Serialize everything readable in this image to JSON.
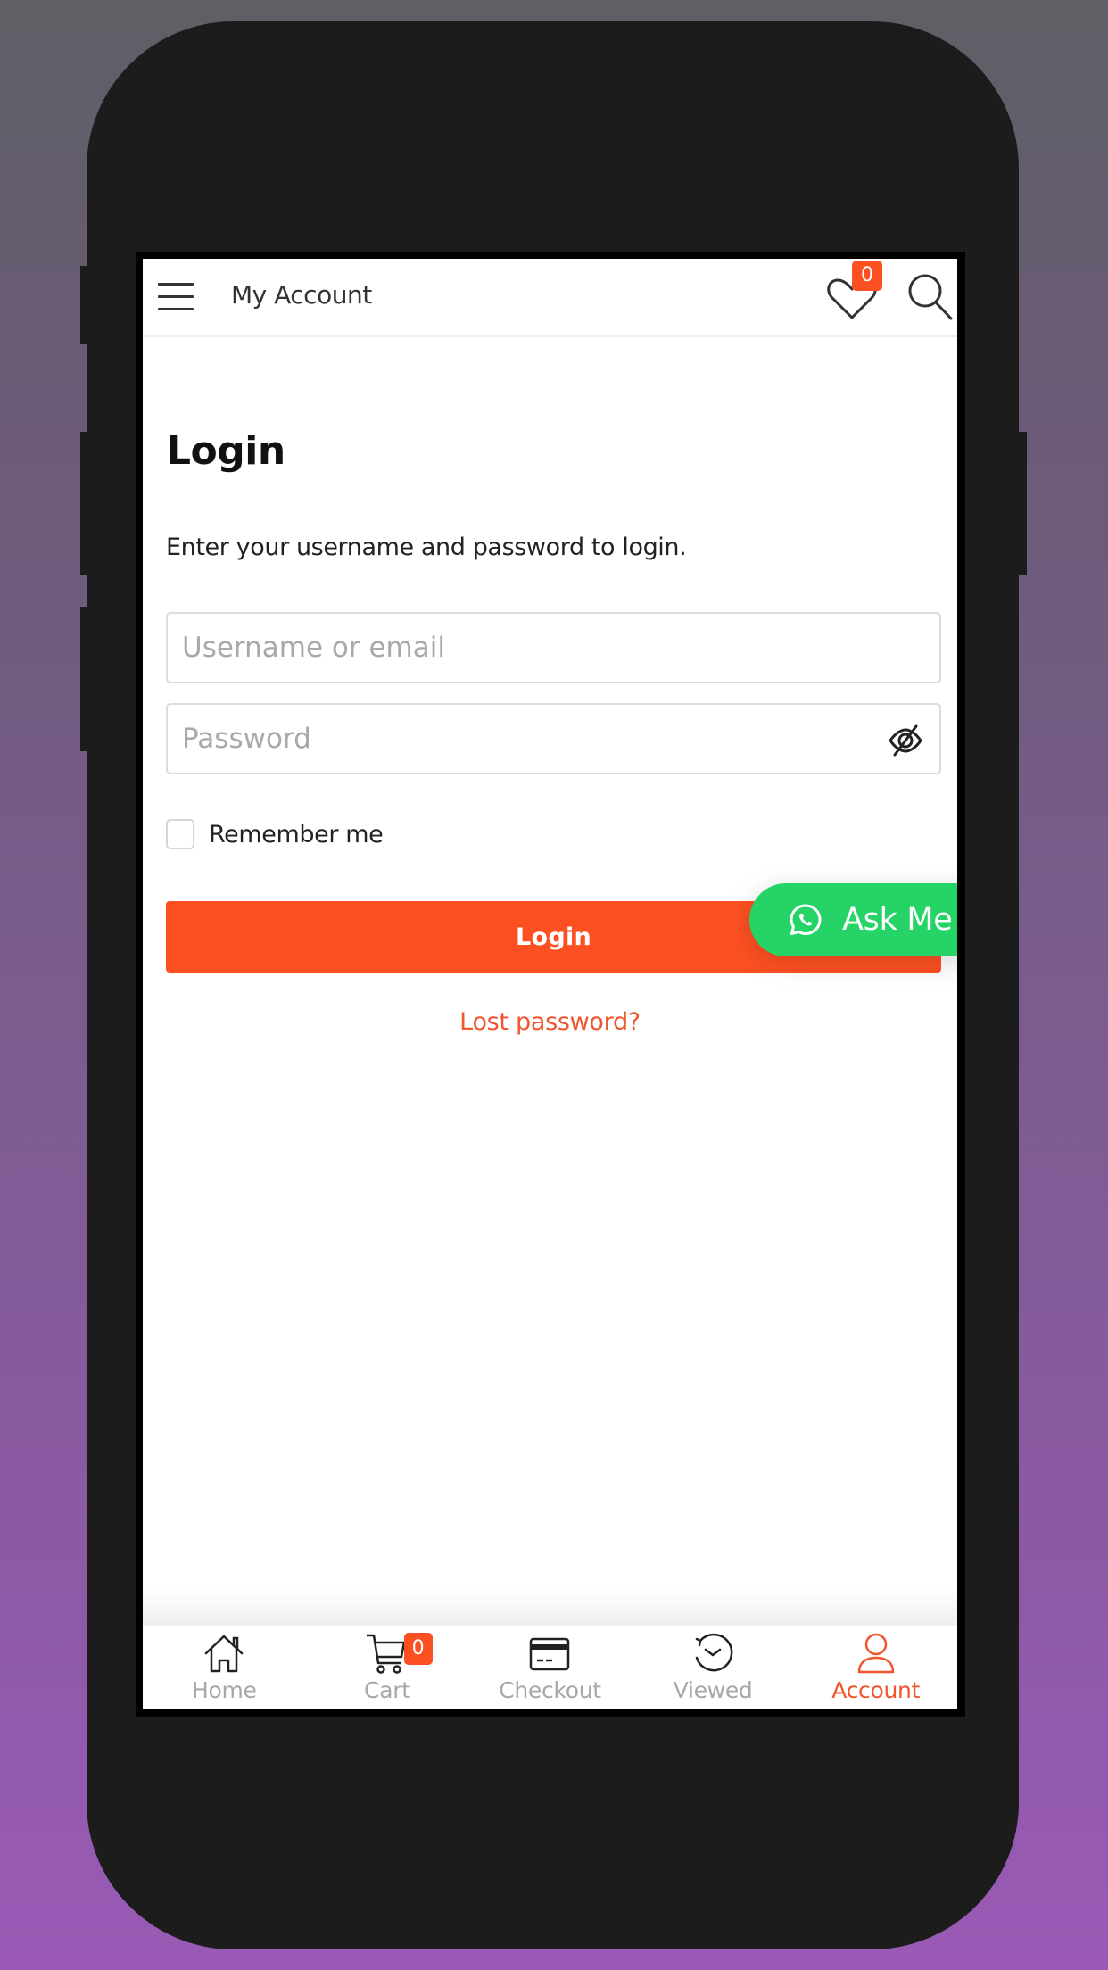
{
  "header": {
    "title": "My Account",
    "wishlist_count": "0",
    "icons": [
      "menu-icon",
      "heart-icon",
      "search-icon"
    ]
  },
  "login": {
    "title": "Login",
    "subtitle": "Enter your username and password to login.",
    "username_placeholder": "Username or email",
    "username_value": "",
    "password_placeholder": "Password",
    "password_value": "",
    "remember_label": "Remember me",
    "remember_checked": false,
    "button_label": "Login",
    "lost_password": "Lost password?"
  },
  "floating": {
    "ask_label": "Ask Me",
    "icon": "whatsapp-icon"
  },
  "bottom_nav": {
    "items": [
      {
        "label": "Home",
        "icon": "home-icon"
      },
      {
        "label": "Cart",
        "icon": "cart-icon",
        "badge": "0"
      },
      {
        "label": "Checkout",
        "icon": "credit-card-icon"
      },
      {
        "label": "Viewed",
        "icon": "history-icon"
      },
      {
        "label": "Account",
        "icon": "user-icon",
        "active": true
      }
    ]
  },
  "colors": {
    "accent": "#fc5022",
    "link": "#f0552d",
    "whatsapp": "#25d366",
    "phone_body": "#1c1c1c"
  }
}
